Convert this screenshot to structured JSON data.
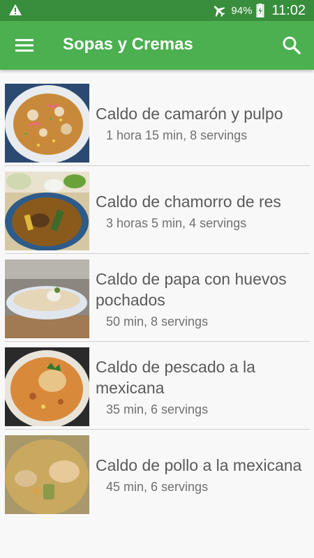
{
  "status_bar": {
    "battery": "94%",
    "time": "11:02",
    "icons": [
      "warning-icon",
      "airplane-icon",
      "battery-charging-icon"
    ]
  },
  "app_bar": {
    "title": "Sopas y Cremas",
    "menu_icon": "hamburger-menu-icon",
    "search_icon": "search-icon",
    "color": "#4caf50",
    "status_color": "#388e3c"
  },
  "recipes": [
    {
      "name": "Caldo de camarón y pulpo",
      "meta": "1 hora 15 min, 8 servings"
    },
    {
      "name": "Caldo de chamorro de res",
      "meta": "3 horas 5 min, 4 servings"
    },
    {
      "name": "Caldo de papa con huevos pochados",
      "meta": "50 min, 8 servings"
    },
    {
      "name": "Caldo de pescado a la mexicana",
      "meta": "35 min, 6 servings"
    },
    {
      "name": "Caldo de pollo a la mexicana",
      "meta": "45 min, 6 servings"
    }
  ]
}
